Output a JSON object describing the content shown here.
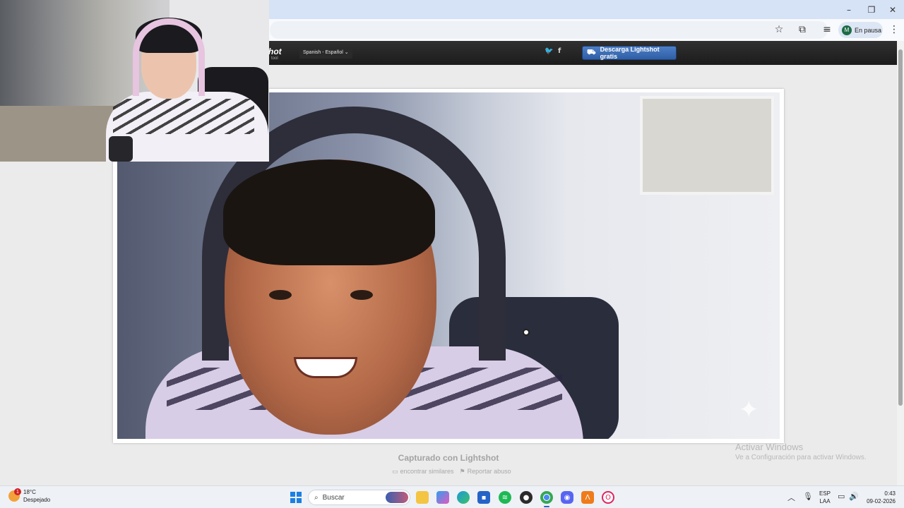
{
  "browser": {
    "window_controls": {
      "minimize": "–",
      "restore": "❐",
      "close": "✕"
    },
    "toolbar": {
      "profile_label": "En pausa",
      "profile_initial": "M"
    }
  },
  "lightshot": {
    "logo": "hot",
    "logo_sub": "tool",
    "language": "Spanish - Español",
    "social": {
      "twitter": "🐦",
      "facebook": "f"
    },
    "download_button": "Descarga Lightshot gratis",
    "captured_with": "Capturado con Lightshot",
    "links": {
      "find_similar": "encontrar similares",
      "report_abuse": "Reportar abuso"
    }
  },
  "watermark": {
    "title": "Activar Windows",
    "subtitle": "Ve a Configuración para activar Windows."
  },
  "taskbar": {
    "weather": {
      "temp": "18°C",
      "condition": "Despejado",
      "badge": "1"
    },
    "search_placeholder": "Buscar",
    "language": {
      "line1": "ESP",
      "line2": "LAA"
    },
    "clock": {
      "time": "0:43",
      "date": "09-02-2026"
    },
    "apps": [
      "file-explorer",
      "copilot",
      "edge",
      "microsoft-store",
      "spotify",
      "chrome-beta",
      "chrome",
      "discord",
      "app-orange",
      "opera"
    ]
  },
  "colors": {
    "header_bg": "#252525",
    "download_button": "#3a6cb5",
    "page_bg": "#ebebeb",
    "taskbar_bg": "#eef1f6"
  }
}
